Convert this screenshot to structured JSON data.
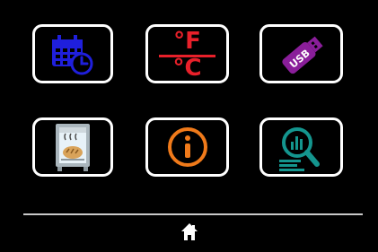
{
  "screen": {
    "tiles": [
      {
        "id": "schedule",
        "icon": "calendar-clock-icon",
        "color": "#1f1fdc"
      },
      {
        "id": "units",
        "icon": "temperature-units-icon",
        "color": "#e8202a",
        "top_label": "°F",
        "bottom_label": "°C"
      },
      {
        "id": "usb",
        "icon": "usb-drive-icon",
        "color": "#8a1e9a",
        "label": "USB"
      },
      {
        "id": "oven",
        "icon": "oven-bread-icon",
        "color": "#aab6bd"
      },
      {
        "id": "info",
        "icon": "info-icon",
        "color": "#f07a1a"
      },
      {
        "id": "analytics",
        "icon": "magnifier-chart-icon",
        "color": "#14958e"
      }
    ],
    "footer": {
      "icon": "home-icon",
      "color": "#ffffff"
    }
  }
}
